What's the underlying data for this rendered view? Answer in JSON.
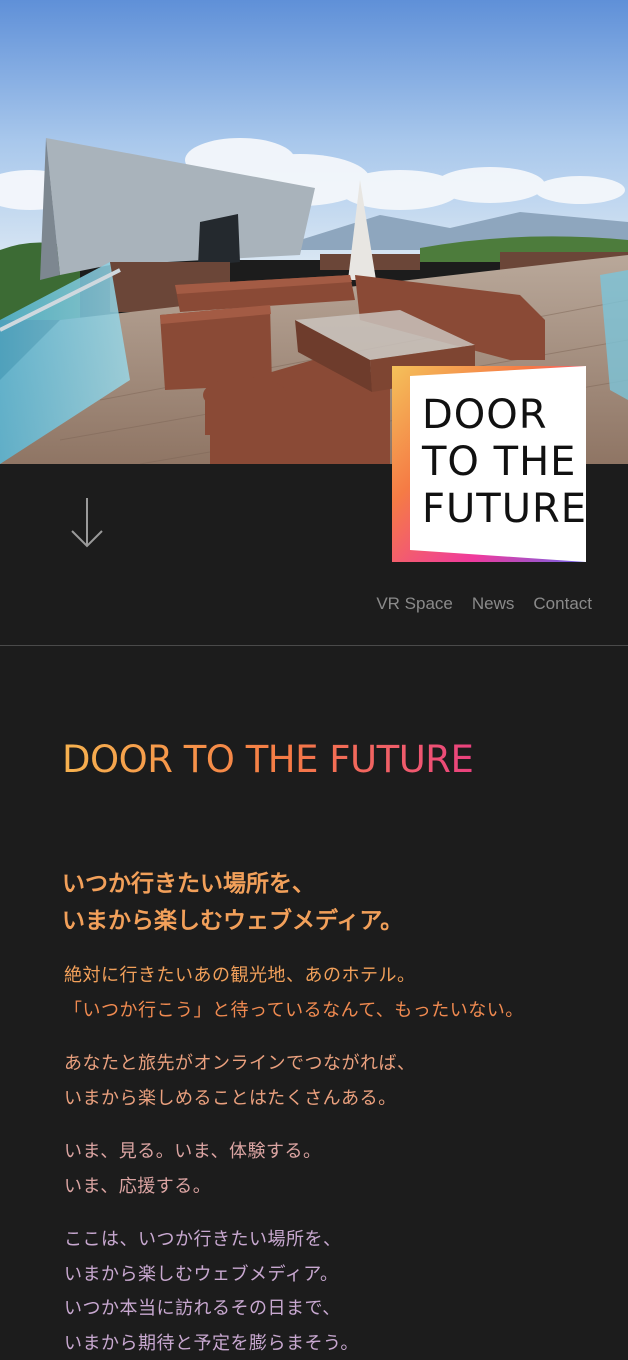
{
  "hero": {
    "alt": "Rooftop terrace with wicker sofas and mountain view"
  },
  "logo": {
    "lines": [
      "DOOR",
      "TO THE",
      "FUTURE"
    ]
  },
  "scroll": {
    "icon": "arrow-down-icon"
  },
  "nav": {
    "items": [
      {
        "label": "VR Space"
      },
      {
        "label": "News"
      },
      {
        "label": "Contact"
      }
    ]
  },
  "main": {
    "title": "DOOR TO THE FUTURE",
    "lead": [
      "いつか行きたい場所を、",
      "いまから楽しむウェブメディア。"
    ],
    "paragraphs": [
      [
        "絶対に行きたいあの観光地、あのホテル。",
        "「いつか行こう」と待っているなんて、もったいない。"
      ],
      [
        "あなたと旅先がオンラインでつながれば、",
        "いまから楽しめることはたくさんある。"
      ],
      [
        "いま、見る。いま、体験する。",
        "いま、応援する。"
      ],
      [
        "ここは、いつか行きたい場所を、",
        "いまから楽しむウェブメディア。",
        "いつか本当に訪れるその日まで、",
        "いまから期待と予定を膨らまそう。"
      ]
    ]
  },
  "colors": {
    "background": "#1c1c1c",
    "nav_text": "#8a8a8a",
    "accent_orange": "#f2a05a",
    "accent_pink": "#e9407e",
    "accent_violet": "#c8a8d0"
  }
}
